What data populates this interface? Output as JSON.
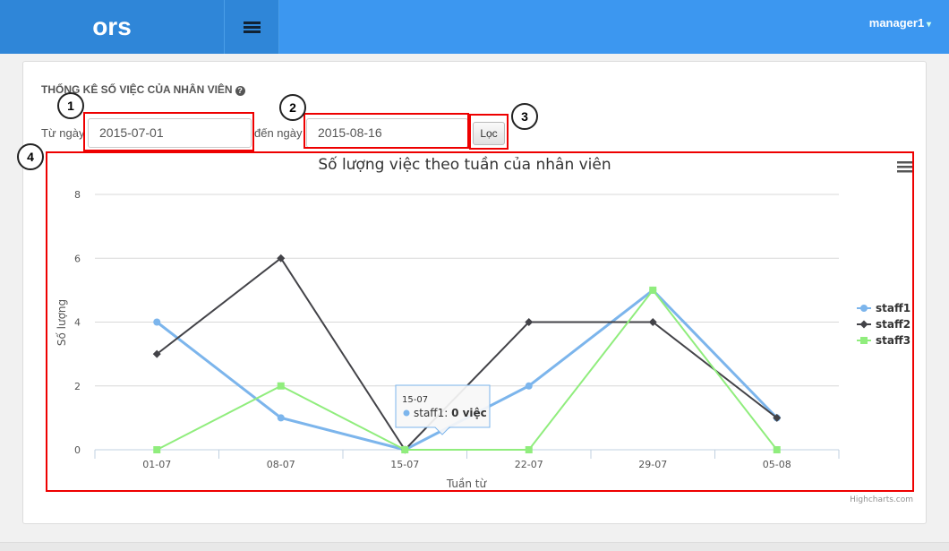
{
  "header": {
    "brand": "ors",
    "user": "manager1"
  },
  "panel": {
    "title": "THỐNG KÊ SỐ VIỆC CỦA NHÂN VIÊN",
    "from_label": "Từ ngày",
    "from_value": "2015-07-01",
    "to_label": "đến ngày",
    "to_value": "2015-08-16",
    "filter_label": "Lọc"
  },
  "annotations": [
    "1",
    "2",
    "3",
    "4"
  ],
  "tooltip": {
    "category": "15-07",
    "series": "staff1",
    "value_text": "0 việc"
  },
  "credits": "Highcharts.com",
  "chart_data": {
    "type": "line",
    "title": "Số lượng việc theo tuần của nhân viên",
    "xlabel": "Tuần từ",
    "ylabel": "Số lượng",
    "categories": [
      "01-07",
      "08-07",
      "15-07",
      "22-07",
      "29-07",
      "05-08"
    ],
    "yticks": [
      0,
      2,
      4,
      6,
      8
    ],
    "ylim": [
      0,
      8
    ],
    "grid": true,
    "legend": "right",
    "series": [
      {
        "name": "staff1",
        "color": "#7cb5ec",
        "marker": "circle",
        "values": [
          4,
          1,
          0,
          2,
          5,
          1
        ]
      },
      {
        "name": "staff2",
        "color": "#434348",
        "marker": "diamond",
        "values": [
          3,
          6,
          0,
          4,
          4,
          1
        ]
      },
      {
        "name": "staff3",
        "color": "#90ed7d",
        "marker": "square",
        "values": [
          0,
          2,
          0,
          0,
          5,
          0
        ]
      }
    ]
  }
}
